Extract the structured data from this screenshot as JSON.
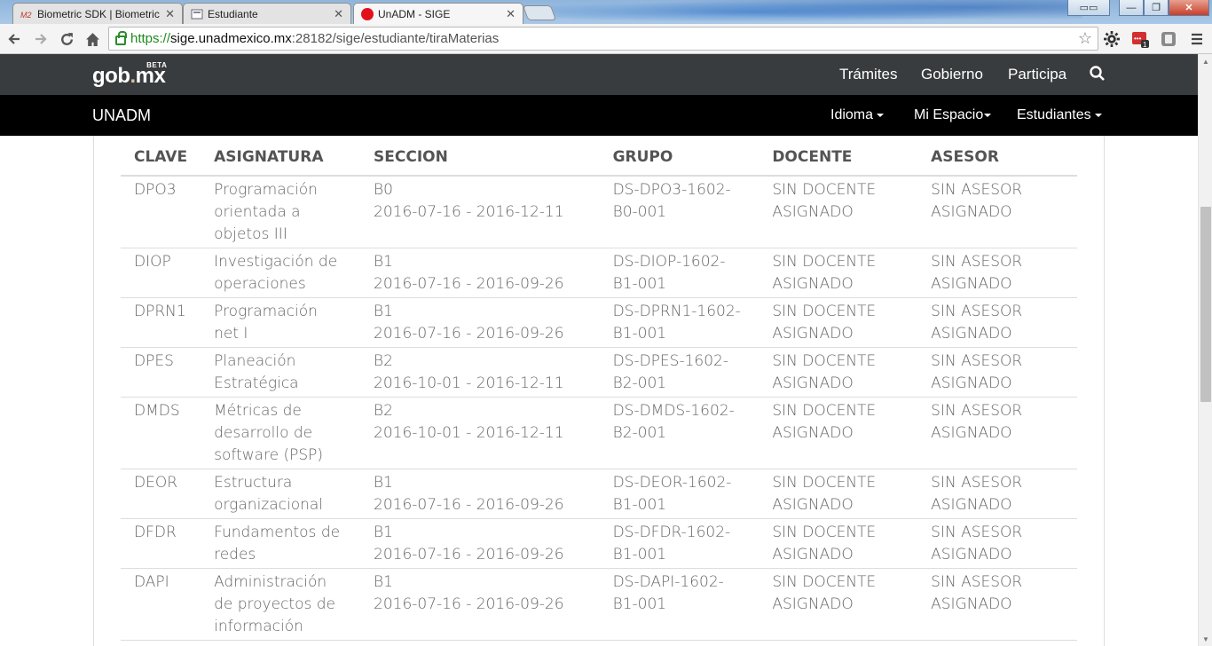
{
  "browser": {
    "tabs": [
      {
        "title": "Biometric SDK | Biometric",
        "favicon": "m2-icon",
        "active": false
      },
      {
        "title": "Estudiante",
        "favicon": "page-icon",
        "active": false
      },
      {
        "title": "UnADM - SIGE",
        "favicon": "red-dot-icon",
        "active": true
      }
    ],
    "url": {
      "scheme": "https://",
      "host": "sige.unadmexico.mx",
      "rest": ":28182/sige/estudiante/tiraMaterias"
    }
  },
  "gov_header": {
    "logo": "gob",
    "logo_dot": ".",
    "logo_suffix": "mx",
    "logo_badge": "BETA",
    "nav": [
      "Trámites",
      "Gobierno",
      "Participa"
    ]
  },
  "site_nav": {
    "brand": "UNADM",
    "menus": [
      "Idioma",
      "Mi Espacio",
      "Estudiantes"
    ]
  },
  "table": {
    "headers": [
      "CLAVE",
      "ASIGNATURA",
      "SECCION",
      "GRUPO",
      "DOCENTE",
      "ASESOR"
    ],
    "rows": [
      {
        "clave": "DPO3",
        "asignatura": "Programación orientada a objetos III",
        "seccion": "B0",
        "fechas": "2016-07-16 - 2016-12-11",
        "grupo": "DS-DPO3-1602-B0-001",
        "docente": "SIN DOCENTE ASIGNADO",
        "asesor": "SIN ASESOR ASIGNADO"
      },
      {
        "clave": "DIOP",
        "asignatura": "Investigación de operaciones",
        "seccion": "B1",
        "fechas": "2016-07-16 - 2016-09-26",
        "grupo": "DS-DIOP-1602-B1-001",
        "docente": "SIN DOCENTE ASIGNADO",
        "asesor": "SIN ASESOR ASIGNADO"
      },
      {
        "clave": "DPRN1",
        "asignatura": "Programación net I",
        "seccion": "B1",
        "fechas": "2016-07-16 - 2016-09-26",
        "grupo": "DS-DPRN1-1602-B1-001",
        "docente": "SIN DOCENTE ASIGNADO",
        "asesor": "SIN ASESOR ASIGNADO"
      },
      {
        "clave": "DPES",
        "asignatura": "Planeación Estratégica",
        "seccion": "B2",
        "fechas": "2016-10-01 - 2016-12-11",
        "grupo": "DS-DPES-1602-B2-001",
        "docente": "SIN DOCENTE ASIGNADO",
        "asesor": "SIN ASESOR ASIGNADO"
      },
      {
        "clave": "DMDS",
        "asignatura": "Métricas de desarrollo de software (PSP)",
        "seccion": "B2",
        "fechas": "2016-10-01 - 2016-12-11",
        "grupo": "DS-DMDS-1602-B2-001",
        "docente": "SIN DOCENTE ASIGNADO",
        "asesor": "SIN ASESOR ASIGNADO"
      },
      {
        "clave": "DEOR",
        "asignatura": "Estructura organizacional",
        "seccion": "B1",
        "fechas": "2016-07-16 - 2016-09-26",
        "grupo": "DS-DEOR-1602-B1-001",
        "docente": "SIN DOCENTE ASIGNADO",
        "asesor": "SIN ASESOR ASIGNADO"
      },
      {
        "clave": "DFDR",
        "asignatura": "Fundamentos de redes",
        "seccion": "B1",
        "fechas": "2016-07-16 - 2016-09-26",
        "grupo": "DS-DFDR-1602-B1-001",
        "docente": "SIN DOCENTE ASIGNADO",
        "asesor": "SIN ASESOR ASIGNADO"
      },
      {
        "clave": "DAPI",
        "asignatura": "Administración de proyectos de información",
        "seccion": "B1",
        "fechas": "2016-07-16 - 2016-09-26",
        "grupo": "DS-DAPI-1602-B1-001",
        "docente": "SIN DOCENTE ASIGNADO",
        "asesor": "SIN ASESOR ASIGNADO"
      }
    ]
  },
  "colors": {
    "gov_bar": "#393c3e",
    "site_bar": "#000000",
    "secure_url": "#1f8a1f"
  }
}
